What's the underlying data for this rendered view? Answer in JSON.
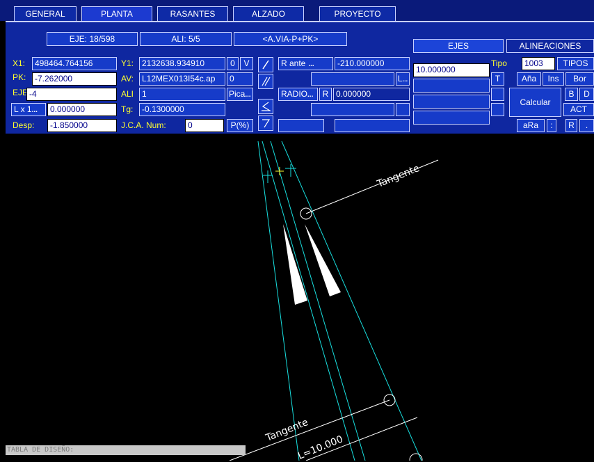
{
  "tabs": [
    "GENERAL",
    "PLANTA",
    "RASANTES",
    "ALZADO",
    "PROYECTO"
  ],
  "header": {
    "eje": "EJE: 18/598",
    "ali": "ALI: 5/5",
    "via": "<A.VIA-P+PK>"
  },
  "right_tabs": {
    "ejes": "EJES",
    "alineaciones": "ALINEACIONES"
  },
  "fields": {
    "x1_label": "X1:",
    "x1_value": "498464.764156",
    "pk_label": "PK:",
    "pk_value": "-7.262000",
    "eje_label": "EJE",
    "eje_value": "-4",
    "lx1_label": "L x 1",
    "lx1_value": "0.000000",
    "desp_label": "Desp:",
    "desp_value": "-1.850000",
    "y1_label": "Y1:",
    "y1_value": "2132638.934910",
    "av_label": "AV:",
    "av_value": "L12MEX013I54c.ap",
    "ali_label": "ALI",
    "ali_value": "1",
    "tg_label": "Tg:",
    "tg_value": "-0.1300000",
    "jca_label": "J.C.A. Num:",
    "jca_value": "0",
    "r_ante_label": "R ante",
    "r_ante_value": "-210.000000",
    "radio_label": "RADIO",
    "r_label": "R",
    "radio_value": "0.000000",
    "l_value": "10.000000",
    "tipo_label": "Tipo",
    "tipo_value": "1003"
  },
  "buttons": {
    "zero": "0",
    "v": "V",
    "zero2": "0",
    "pica": "Pica",
    "p_pct": "P(%)",
    "l": "L",
    "t": "T",
    "tipos": "TIPOS",
    "ana": "Aña",
    "ins": "Ins",
    "bor": "Bor",
    "b": "B",
    "d": "D",
    "calcular": "Calcular",
    "act": "ACT",
    "ara": "aRa",
    "colon": ":",
    "r": "R",
    "dot": ".",
    "dots": "..."
  },
  "canvas_labels": {
    "tangente_top": "Tangente",
    "tangente_bottom": "Tangente",
    "l_label": "L=10.000"
  },
  "status": "TABLA DE DISEÑO:"
}
